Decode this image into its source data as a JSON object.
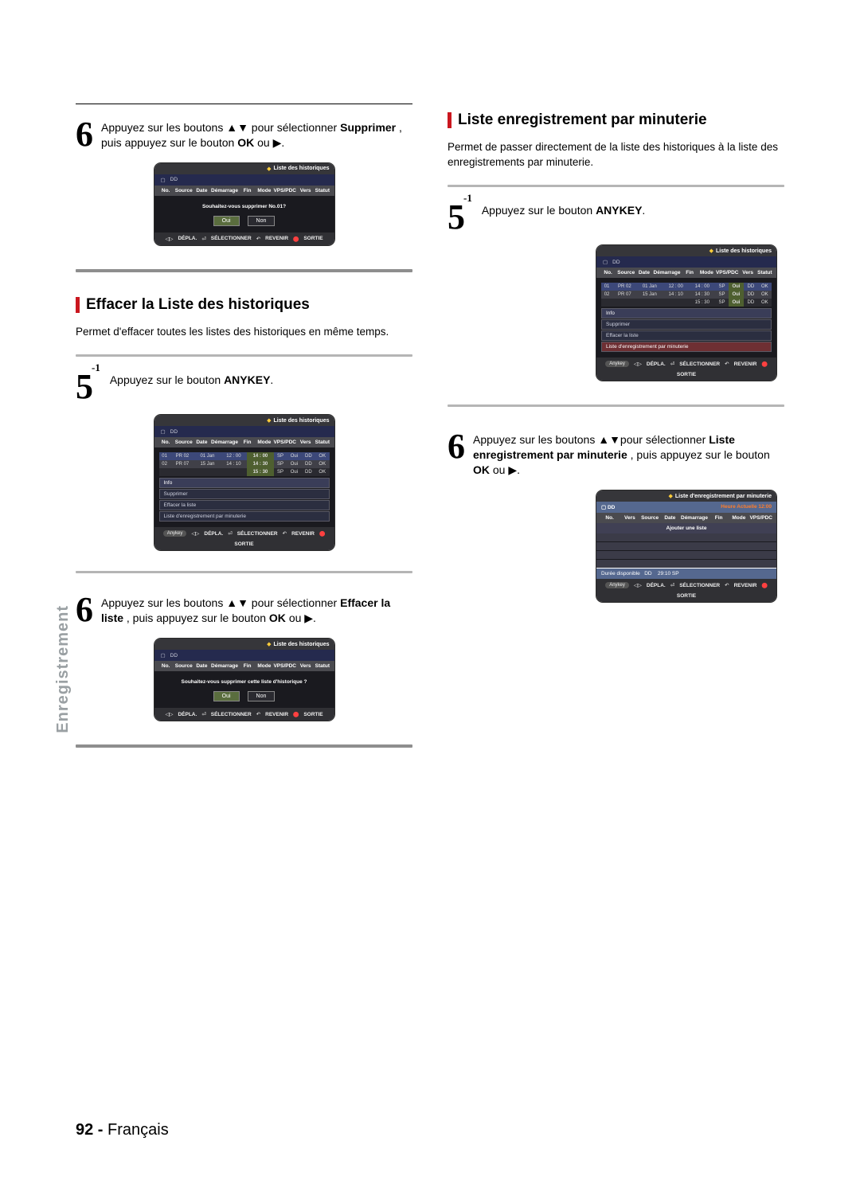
{
  "sideTab": "Enregistrement",
  "footer": {
    "page": "92 -",
    "lang": "Français"
  },
  "left": {
    "step6a": {
      "num": "6",
      "text_pre": "Appuyez sur les boutons ▲▼ pour sélectionner ",
      "bold": "Supprimer",
      "text_mid": ", puis appuyez sur le bouton ",
      "bold2": "OK",
      "text_post": " ou ▶."
    },
    "osd_delete_one": {
      "title": "Liste des historiques",
      "dd": "DD",
      "prompt": "Souhaitez-vous supprimer No.01?",
      "yes": "Oui",
      "no": "Non",
      "cols": [
        "No.",
        "Source",
        "Date",
        "Démarrage",
        "Fin",
        "Mode",
        "VPS/PDC",
        "Vers",
        "Statut"
      ],
      "foot": {
        "d": "DÉPLA.",
        "s": "SÉLECTIONNER",
        "r": "REVENIR",
        "x": "SORTIE"
      }
    },
    "section_clear": {
      "title": "Effacer la Liste des historiques",
      "desc": "Permet d'effacer toutes les listes des historiques en même temps."
    },
    "step5": {
      "num": "5",
      "sup": "-1",
      "text_pre": "Appuyez sur le bouton ",
      "bold": "ANYKEY",
      "text_post": "."
    },
    "osd_menu": {
      "title": "Liste des historiques",
      "dd": "DD",
      "cols": [
        "No.",
        "Source",
        "Date",
        "Démarrage",
        "Fin",
        "Mode",
        "VPS/PDC",
        "Vers",
        "Statut"
      ],
      "rows": [
        {
          "no": "01",
          "src": "PR 02",
          "date": "01 Jan",
          "dem": "12 : 00",
          "fin": "14 : 00",
          "mode": "SP",
          "vps": "Oui",
          "vers": "DD",
          "stat": "OK",
          "hiCol": "fin",
          "sel": true
        },
        {
          "no": "02",
          "src": "PR 07",
          "date": "15 Jan",
          "dem": "14 : 10",
          "fin": "14 : 30",
          "mode": "SP",
          "vps": "Oui",
          "vers": "DD",
          "stat": "OK",
          "hiCol": "fin"
        },
        {
          "no": "",
          "src": "",
          "date": "",
          "dem": "",
          "fin": "15 : 30",
          "mode": "SP",
          "vps": "Oui",
          "vers": "DD",
          "stat": "OK",
          "hiCol": "fin",
          "dark": true
        }
      ],
      "menu": [
        "Info",
        "Supprimer",
        "Effacer la liste",
        "Liste d'enregistrement par minuterie"
      ],
      "anykey": "Anykey",
      "foot": {
        "d": "DÉPLA.",
        "s": "SÉLECTIONNER",
        "r": "REVENIR",
        "x": "SORTIE"
      }
    },
    "step6b": {
      "num": "6",
      "text_pre": "Appuyez sur les boutons ▲▼ pour sélectionner ",
      "bold": "Effacer la liste",
      "text_mid": ", puis appuyez sur le bouton ",
      "bold2": "OK",
      "text_post": " ou ▶."
    },
    "osd_delete_all": {
      "title": "Liste des historiques",
      "dd": "DD",
      "prompt": "Souhaitez-vous supprimer cette liste d'historique ?",
      "yes": "Oui",
      "no": "Non",
      "cols": [
        "No.",
        "Source",
        "Date",
        "Démarrage",
        "Fin",
        "Mode",
        "VPS/PDC",
        "Vers",
        "Statut"
      ],
      "foot": {
        "d": "DÉPLA.",
        "s": "SÉLECTIONNER",
        "r": "REVENIR",
        "x": "SORTIE"
      }
    }
  },
  "right": {
    "section_timer": {
      "title": "Liste enregistrement par minuterie",
      "desc": "Permet de passer directement de la liste des historiques à la liste des enregistrements par minuterie."
    },
    "step5": {
      "num": "5",
      "sup": "-1",
      "text_pre": "Appuyez sur le bouton ",
      "bold": "ANYKEY",
      "text_post": "."
    },
    "osd_menu": {
      "title": "Liste des historiques",
      "dd": "DD",
      "cols": [
        "No.",
        "Source",
        "Date",
        "Démarrage",
        "Fin",
        "Mode",
        "VPS/PDC",
        "Vers",
        "Statut"
      ],
      "rows": [
        {
          "no": "01",
          "src": "PR 02",
          "date": "01 Jan",
          "dem": "12 : 00",
          "fin": "14 : 00",
          "mode": "SP",
          "vps": "Oui",
          "vers": "DD",
          "stat": "OK",
          "sel": true,
          "hiCol": "vps"
        },
        {
          "no": "02",
          "src": "PR 07",
          "date": "15 Jan",
          "dem": "14 : 10",
          "fin": "14 : 30",
          "mode": "SP",
          "vps": "Oui",
          "vers": "DD",
          "stat": "OK",
          "hiCol": "vps"
        },
        {
          "no": "",
          "src": "",
          "date": "",
          "dem": "",
          "fin": "15 : 30",
          "mode": "SP",
          "vps": "Oui",
          "vers": "DD",
          "stat": "OK",
          "dark": true,
          "hiCol": "vps"
        }
      ],
      "menu": [
        "Info",
        "Supprimer",
        "Effacer la liste",
        "Liste d'enregistrement par minuterie"
      ],
      "anykey": "Anykey",
      "foot": {
        "d": "DÉPLA.",
        "s": "SÉLECTIONNER",
        "r": "REVENIR",
        "x": "SORTIE"
      }
    },
    "step6": {
      "num": "6",
      "text_pre": "Appuyez sur les boutons ▲▼pour sélectionner ",
      "bold": "Liste enregistrement par minuterie",
      "text_mid": ", puis appuyez sur le bouton ",
      "bold2": "OK",
      "text_post": " ou ▶."
    },
    "osd_timer": {
      "title": "Liste d'enregistrement par minuterie",
      "dd": "DD",
      "clock_label": "Heure Actuelle",
      "clock": "12:00",
      "cols": [
        "No.",
        "Vers",
        "Source",
        "Date",
        "Démarrage",
        "Fin",
        "Mode",
        "VPS/PDC"
      ],
      "add": "Ajouter une liste",
      "avail_label": "Durée disponible",
      "avail_disk": "DD",
      "avail_time": "29:10  SP",
      "anykey": "Anykey",
      "foot": {
        "d": "DÉPLA.",
        "s": "SÉLECTIONNER",
        "r": "REVENIR",
        "x": "SORTIE"
      }
    }
  }
}
